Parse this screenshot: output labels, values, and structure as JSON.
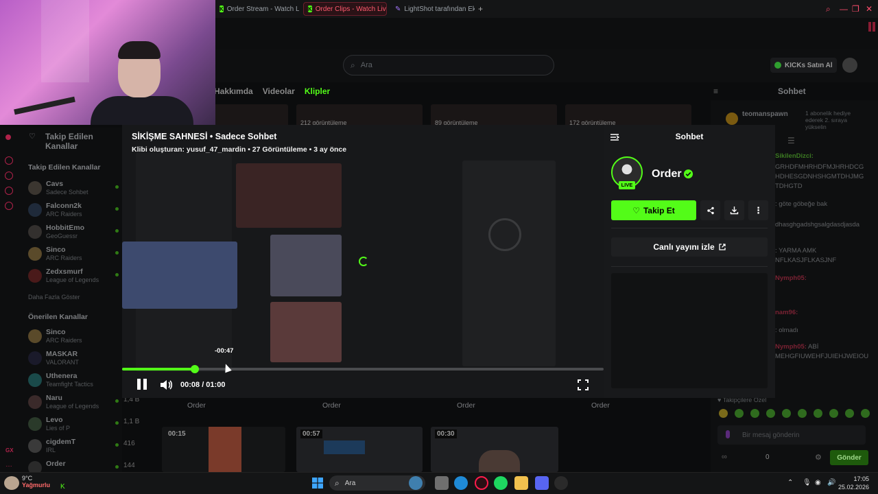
{
  "browser": {
    "tabs": [
      {
        "label": "Order Stream - Watch Live",
        "active": false
      },
      {
        "label": "Order Clips - Watch Live c",
        "active": true
      },
      {
        "label": "LightShot tarafından Ekran",
        "active": false
      }
    ]
  },
  "kick": {
    "search_placeholder": "Ara",
    "buy_kicks": "KICKs Satın Al",
    "profile_tabs": [
      "Hakkımda",
      "Videolar",
      "Klipler"
    ],
    "bg_chat_title": "Sohbet",
    "thumb_views": [
      "212 görüntüleme",
      "89 görüntüleme",
      "172 görüntüleme"
    ]
  },
  "sidebar": {
    "followed_header": "Takip Edilen Kanallar",
    "followed_title": "Takip Edilen Kanallar",
    "followed": [
      {
        "name": "Cavs",
        "game": "Sadece Sohbet"
      },
      {
        "name": "Falconn2k",
        "game": "ARC Raiders"
      },
      {
        "name": "HobbitEmo",
        "game": "GeoGuessr"
      },
      {
        "name": "Sinco",
        "game": "ARC Raiders"
      },
      {
        "name": "Zedxsmurf",
        "game": "League of Legends"
      }
    ],
    "show_more": "Daha Fazla Göster",
    "recommended_title": "Önerilen Kanallar",
    "recommended": [
      {
        "name": "Sinco",
        "game": "ARC Raiders",
        "count": ""
      },
      {
        "name": "MASKAR",
        "game": "VALORANT",
        "count": ""
      },
      {
        "name": "Uthenera",
        "game": "Teamfight Tactics",
        "count": ""
      },
      {
        "name": "Naru",
        "game": "League of Legends",
        "count": "1,4 B"
      },
      {
        "name": "Levo",
        "game": "Lies of P",
        "count": "1,1 B"
      },
      {
        "name": "cigdemT",
        "game": "IRL",
        "count": "416"
      },
      {
        "name": "Order",
        "game": "",
        "count": "144"
      }
    ]
  },
  "clip": {
    "title": "SİKİŞME SAHNESİ • Sadece Sohbet",
    "meta": "Klibi oluşturan: yusuf_47_mardin • 27 Görüntüleme • 3 ay önce",
    "hover_time": "-00:47",
    "time_display": "00:08 / 01:00",
    "progress": 0.151,
    "hover_progress": 0.215
  },
  "chat_panel": {
    "title": "Sohbet",
    "streamer": "Order",
    "live_badge": "LIVE",
    "follow_label": "Takip Et",
    "watch_live_label": "Canlı yayını izle"
  },
  "bg_chat": {
    "user_top": "teomanspawn",
    "user_top_note": "1 abonelik hediye ederek 2. sıraya yükselin",
    "messages": [
      {
        "user": "SikilenDizci:",
        "text": ""
      },
      {
        "user": "",
        "text": "GRHDFMHRHDFMJHRHDCG"
      },
      {
        "user": "",
        "text": "HDHESGDNHSHGMTDHJMG"
      },
      {
        "user": "",
        "text": "TDHGTD"
      },
      {
        "user": "",
        "text": ": göte göbeğe bak"
      },
      {
        "user": "",
        "text": "dhasghgadshgsalgdasdjasda"
      },
      {
        "user": "",
        "text": ": YARMA AMK"
      },
      {
        "user": "",
        "text": "NFLKASJFLKASJNF"
      },
      {
        "user": "Nymph05:",
        "text": ""
      },
      {
        "user": "nam96:",
        "text": ""
      },
      {
        "user": "",
        "text": ": olmadı"
      },
      {
        "user": "Nymph05:",
        "text": " ABİ"
      },
      {
        "user": "",
        "text": "MEHGFIUWEHFJUIEHJWEIOU"
      }
    ],
    "followers_only": "Takipçilere Özel",
    "input_placeholder": "Bir mesaj gönderin",
    "points": "0",
    "send_label": "Gönder"
  },
  "grid": {
    "card_owner": "Order",
    "card_duration_1": "00:15",
    "card_duration_2": "00:57",
    "card_duration_3": "00:30"
  },
  "taskbar": {
    "search_label": "Ara",
    "weather_temp": "9°C",
    "weather_desc": "Yağmurlu",
    "time": "17:05",
    "date": "25.02.2026"
  },
  "colors": {
    "kick_green": "#53fc18",
    "accent_red": "#ff4d6d"
  }
}
